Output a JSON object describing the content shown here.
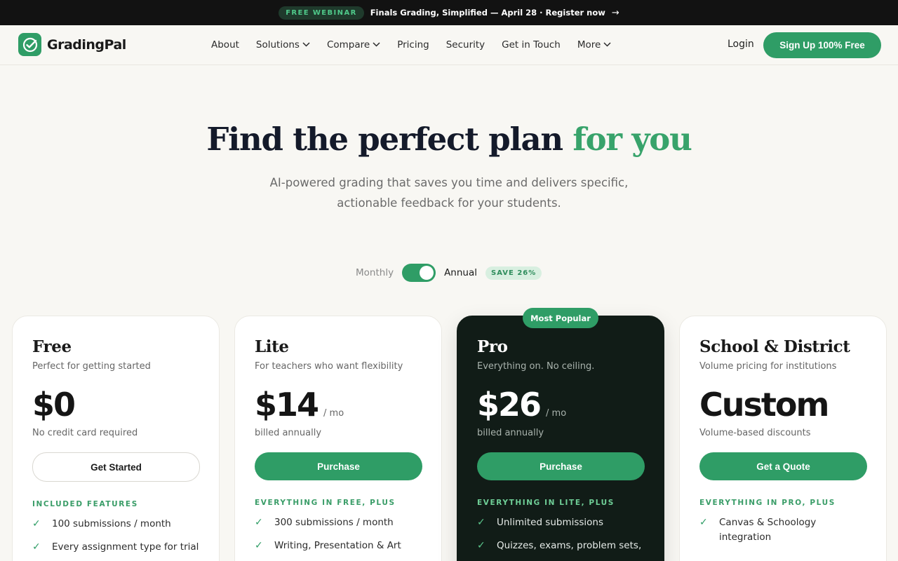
{
  "announcement": {
    "pill": "FREE WEBINAR",
    "message": "Finals Grading, Simplified — April 28 · Register now",
    "arrow": "→"
  },
  "nav": {
    "brand": "GradingPal",
    "links": [
      {
        "label": "About",
        "dropdown": false
      },
      {
        "label": "Solutions",
        "dropdown": true
      },
      {
        "label": "Compare",
        "dropdown": true
      },
      {
        "label": "Pricing",
        "dropdown": false
      },
      {
        "label": "Security",
        "dropdown": false
      },
      {
        "label": "Get in Touch",
        "dropdown": false
      },
      {
        "label": "More",
        "dropdown": true
      }
    ],
    "chevron": "⌄",
    "login": "Login",
    "signup": "Sign Up 100% Free"
  },
  "hero": {
    "title_main": "Find the perfect plan ",
    "title_accent": "for you",
    "subtitle_line1": "AI-powered grading that saves you time and delivers specific,",
    "subtitle_line2": "actionable feedback for your students."
  },
  "billing": {
    "monthly": "Monthly",
    "annual": "Annual",
    "save": "SAVE 26%",
    "annual_selected": true
  },
  "popular_badge": "Most Popular",
  "check_glyph": "✓",
  "plans": [
    {
      "name": "Free",
      "tagline": "Perfect for getting started",
      "price": "$0",
      "per": "",
      "note": "No credit card required",
      "cta": "Get Started",
      "features_heading": "INCLUDED FEATURES",
      "features": [
        "100 submissions / month",
        "Every assignment type for trial"
      ]
    },
    {
      "name": "Lite",
      "tagline": "For teachers who want flexibility",
      "price": "$14",
      "per": "/ mo",
      "note": "billed annually",
      "cta": "Purchase",
      "features_heading": "EVERYTHING IN FREE, PLUS",
      "features": [
        "300 submissions / month",
        "Writing, Presentation & Art"
      ]
    },
    {
      "name": "Pro",
      "tagline": "Everything on. No ceiling.",
      "price": "$26",
      "per": "/ mo",
      "note": "billed annually",
      "cta": "Purchase",
      "features_heading": "EVERYTHING IN LITE, PLUS",
      "features": [
        "Unlimited submissions",
        "Quizzes, exams, problem sets,"
      ]
    },
    {
      "name": "School & District",
      "tagline": "Volume pricing for institutions",
      "price": "Custom",
      "per": "",
      "note": "Volume-based discounts",
      "cta": "Get a Quote",
      "features_heading": "EVERYTHING IN PRO, PLUS",
      "features": [
        "Canvas & Schoology integration"
      ]
    }
  ]
}
